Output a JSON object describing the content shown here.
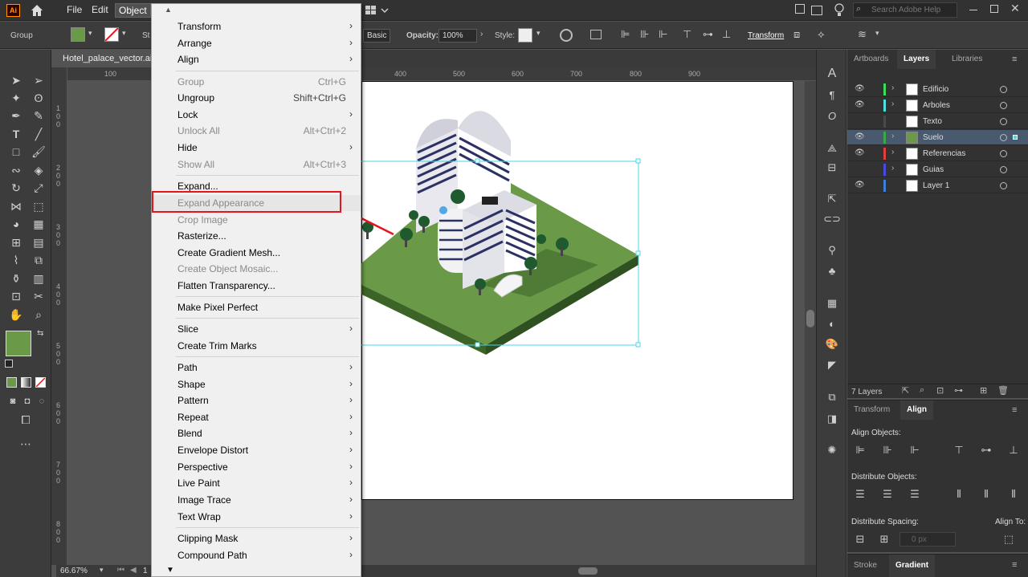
{
  "app": {
    "logo": "Ai"
  },
  "menubar": {
    "items": [
      "File",
      "Edit",
      "Object"
    ],
    "search_placeholder": "Search Adobe Help"
  },
  "control_bar": {
    "selection_label": "Group",
    "stroke_label": "St",
    "style_preset": "Basic",
    "opacity_label": "Opacity:",
    "opacity_value": "100%",
    "style_label": "Style:",
    "transform_label": "Transform",
    "fill_color": "#6a9a48"
  },
  "document": {
    "tab_title": "Hotel_palace_vector.ai*",
    "zoom": "66.67%",
    "page": "1"
  },
  "rulers": {
    "h_ticks": [
      "100",
      "400",
      "500",
      "600",
      "700",
      "800",
      "900"
    ],
    "v_ticks": [
      "1\n0\n0",
      "2\n0\n0",
      "3\n0\n0",
      "4\n0\n0",
      "5\n0\n0",
      "6\n0\n0",
      "7\n0\n0",
      "8\n0\n0"
    ]
  },
  "object_menu": {
    "sections": [
      [
        {
          "label": "Transform",
          "sub": true
        },
        {
          "label": "Arrange",
          "sub": true
        },
        {
          "label": "Align",
          "sub": true
        }
      ],
      [
        {
          "label": "Group",
          "shortcut": "Ctrl+G",
          "disabled": true
        },
        {
          "label": "Ungroup",
          "shortcut": "Shift+Ctrl+G"
        },
        {
          "label": "Lock",
          "sub": true
        },
        {
          "label": "Unlock All",
          "shortcut": "Alt+Ctrl+2",
          "disabled": true
        },
        {
          "label": "Hide",
          "sub": true
        },
        {
          "label": "Show All",
          "shortcut": "Alt+Ctrl+3",
          "disabled": true
        }
      ],
      [
        {
          "label": "Expand..."
        },
        {
          "label": "Expand Appearance",
          "disabled": true
        },
        {
          "label": "Crop Image",
          "disabled": true
        },
        {
          "label": "Rasterize..."
        },
        {
          "label": "Create Gradient Mesh..."
        },
        {
          "label": "Create Object Mosaic...",
          "disabled": true
        },
        {
          "label": "Flatten Transparency..."
        }
      ],
      [
        {
          "label": "Make Pixel Perfect"
        }
      ],
      [
        {
          "label": "Slice",
          "sub": true
        },
        {
          "label": "Create Trim Marks"
        }
      ],
      [
        {
          "label": "Path",
          "sub": true
        },
        {
          "label": "Shape",
          "sub": true
        },
        {
          "label": "Pattern",
          "sub": true
        },
        {
          "label": "Repeat",
          "sub": true
        },
        {
          "label": "Blend",
          "sub": true
        },
        {
          "label": "Envelope Distort",
          "sub": true
        },
        {
          "label": "Perspective",
          "sub": true
        },
        {
          "label": "Live Paint",
          "sub": true
        },
        {
          "label": "Image Trace",
          "sub": true
        },
        {
          "label": "Text Wrap",
          "sub": true
        }
      ],
      [
        {
          "label": "Clipping Mask",
          "sub": true
        },
        {
          "label": "Compound Path",
          "sub": true
        }
      ]
    ]
  },
  "panels": {
    "top_tabs": [
      "Artboards",
      "Layers",
      "Libraries"
    ],
    "layers": [
      {
        "name": "Edificio",
        "color": "#3ddc5a",
        "expand": true,
        "visible": true
      },
      {
        "name": "Arboles",
        "color": "#4fe0e0",
        "expand": true,
        "visible": true
      },
      {
        "name": "Texto",
        "color": "#4a4a4a",
        "expand": false,
        "visible": false
      },
      {
        "name": "Suelo",
        "color": "#3aa84a",
        "expand": true,
        "visible": true,
        "selected": true
      },
      {
        "name": "Referencias",
        "color": "#e04040",
        "expand": true,
        "visible": true
      },
      {
        "name": "Guias",
        "color": "#4a4ae0",
        "expand": true,
        "visible": false
      },
      {
        "name": "Layer 1",
        "color": "#3f7fd8",
        "expand": false,
        "visible": true
      }
    ],
    "layers_count": "7 Layers",
    "align_tabs": [
      "Transform",
      "Align"
    ],
    "align_objects_label": "Align Objects:",
    "distribute_objects_label": "Distribute Objects:",
    "distribute_spacing_label": "Distribute Spacing:",
    "align_to_label": "Align To:",
    "spacing_value": "0 px",
    "bottom_tabs": [
      "Stroke",
      "Gradient"
    ]
  },
  "colors": {
    "highlight": "#e8141b",
    "grass": "#6a9a48",
    "selection": "#49d6e8"
  }
}
